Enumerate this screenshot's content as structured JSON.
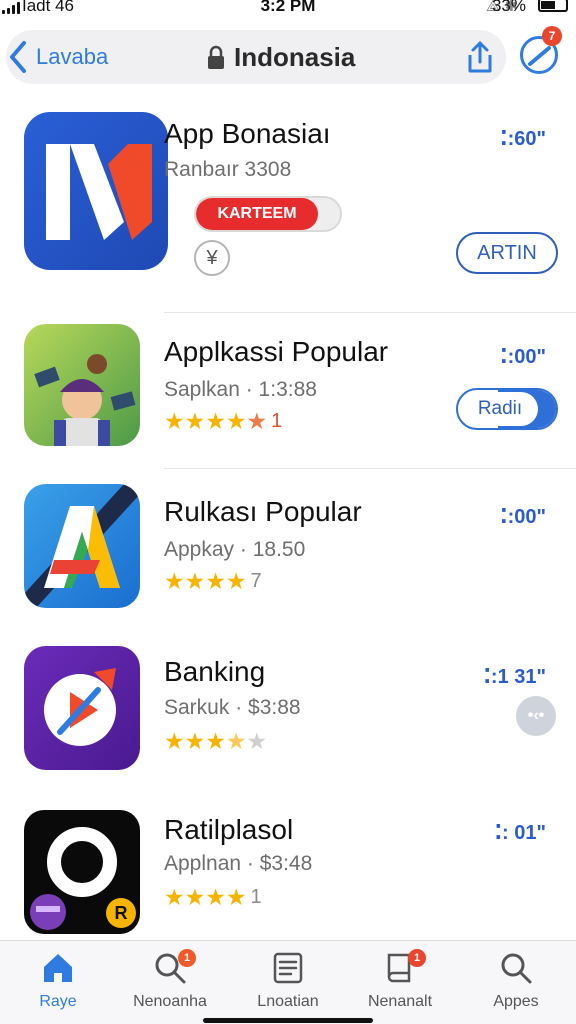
{
  "status": {
    "carrier": "Iadt 46",
    "time": "3:2 PM",
    "battery_pct": "33%"
  },
  "nav": {
    "back_label": "Lavaba",
    "site_title": "Indonasia",
    "badge_count": "7",
    "accent": "#2f7be0"
  },
  "apps": [
    {
      "name": "App Bonasiaı",
      "subtitle": "Ranbaır 3308",
      "price": ":60\"",
      "redeem_label": "KARTEEM",
      "currency_symbol": "¥",
      "action_label": "ARTIN"
    },
    {
      "name": "Applkassi Popular",
      "subtitle": "Saplkan · 1:3:88",
      "price": ":00\"",
      "rating_count": "1",
      "rating": 4,
      "action_label": "Radiı"
    },
    {
      "name": "Rulkası Popular",
      "subtitle": "Appkay · 18.50",
      "price": ":00\"",
      "rating_count": "7",
      "rating": 4
    },
    {
      "name": "Banking",
      "subtitle": "Sarkuk · $3:88",
      "price": ":1 31\"",
      "rating_count": "",
      "rating": 3.5
    },
    {
      "name": "Ratilplasol",
      "subtitle": "Applnan · $3:48",
      "price": ": 01\"",
      "rating_count": "1",
      "rating": 4,
      "icon_badge": "R"
    }
  ],
  "tabs": [
    {
      "label": "Raye",
      "icon": "home-icon",
      "active": true
    },
    {
      "label": "Nenoanha",
      "icon": "search-icon",
      "badge": "1"
    },
    {
      "label": "Lnoatian",
      "icon": "list-icon"
    },
    {
      "label": "Nenanalt",
      "icon": "book-icon",
      "badge": "1"
    },
    {
      "label": "Appes",
      "icon": "search-icon"
    }
  ]
}
